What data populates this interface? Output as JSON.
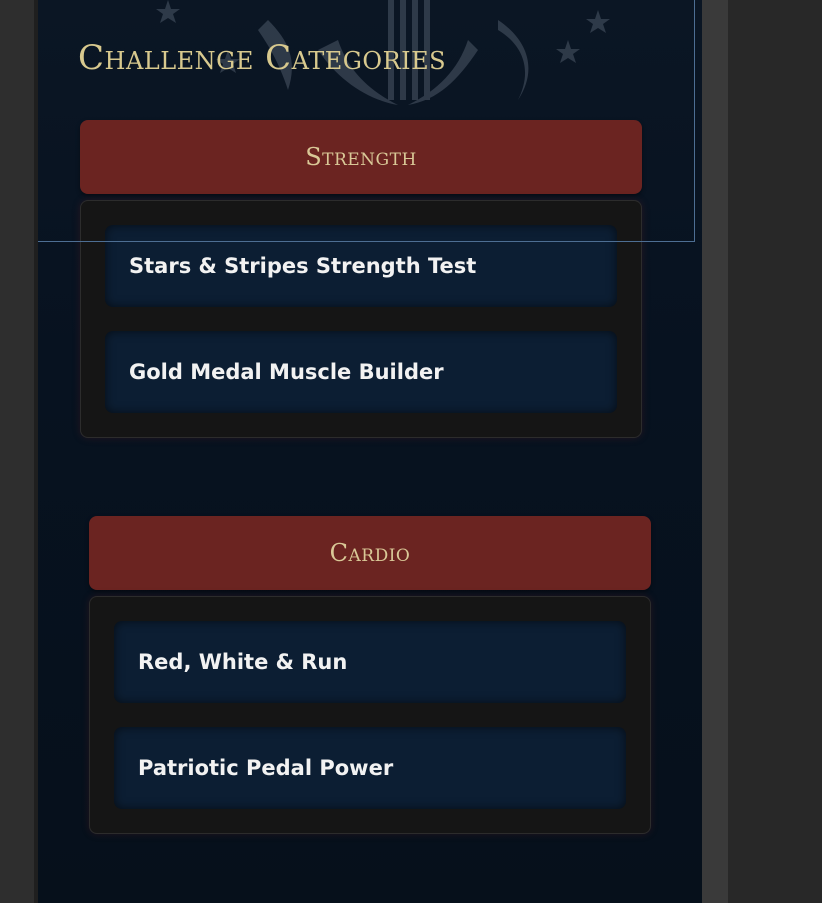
{
  "section_title": "Challenge Categories",
  "categories": [
    {
      "name": "Strength",
      "challenges": [
        {
          "label": "Stars & Stripes Strength Test"
        },
        {
          "label": "Gold Medal Muscle Builder"
        }
      ]
    },
    {
      "name": "Cardio",
      "challenges": [
        {
          "label": "Red, White & Run"
        },
        {
          "label": "Patriotic Pedal Power"
        }
      ]
    }
  ],
  "colors": {
    "panel_bg": "#071220",
    "category_header": "#6b2421",
    "header_text": "#d9c897",
    "title_text": "#d8c98e",
    "challenge_bg": "#0c1e33",
    "selection_outline": "#4d6e93"
  },
  "icons": [
    "eagle-seal-icon",
    "star-icon"
  ]
}
